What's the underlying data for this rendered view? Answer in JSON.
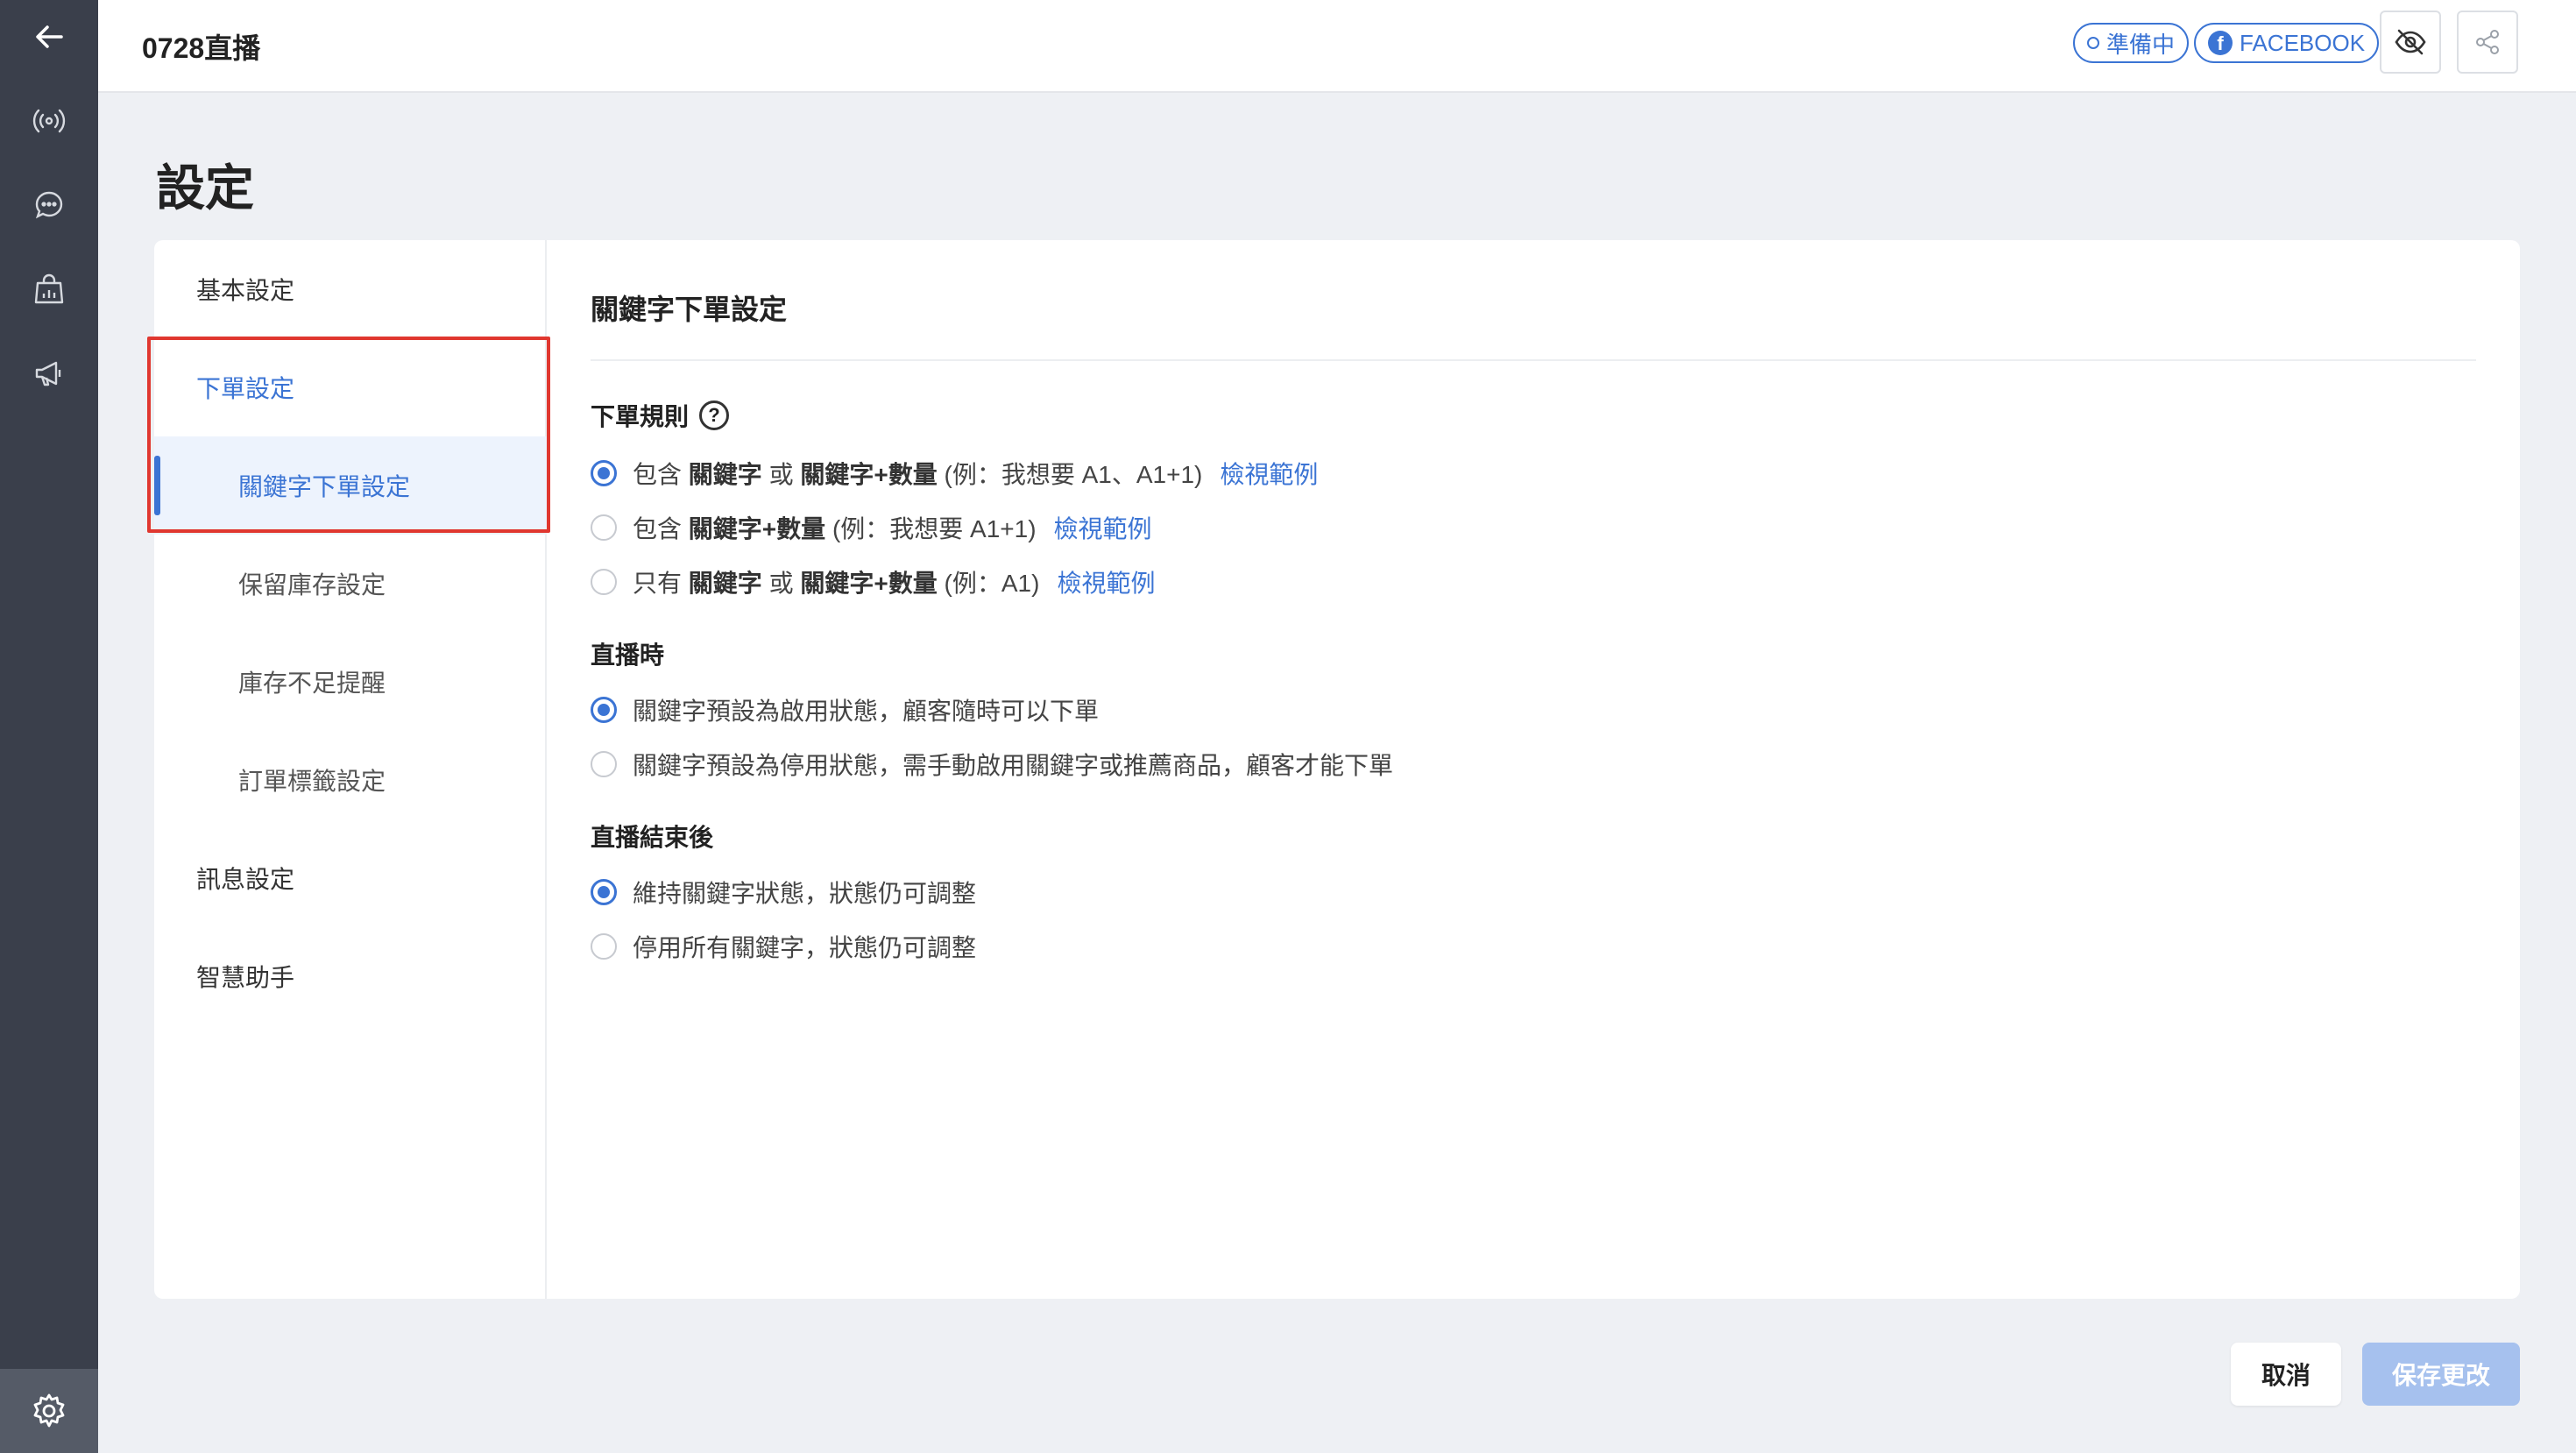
{
  "header": {
    "title": "0728直播",
    "status_badge": "準備中",
    "platform_badge": "FACEBOOK"
  },
  "page": {
    "title": "設定"
  },
  "sidenav": {
    "basic": "基本設定",
    "order": "下單設定",
    "keyword_order": "關鍵字下單設定",
    "reserve_stock": "保留庫存設定",
    "low_stock": "庫存不足提醒",
    "order_tag": "訂單標籤設定",
    "message": "訊息設定",
    "assistant": "智慧助手"
  },
  "content": {
    "title": "關鍵字下單設定",
    "order_rules": {
      "label": "下單規則",
      "options": [
        {
          "prefix": "包含",
          "kw1": "關鍵字",
          "or": "或",
          "kw2": "關鍵字+數量",
          "example": "(例：我想要 A1、A1+1)",
          "link": "檢視範例",
          "checked": true
        },
        {
          "prefix": "包含",
          "kw2": "關鍵字+數量",
          "example": "(例：我想要 A1+1)",
          "link": "檢視範例",
          "checked": false
        },
        {
          "prefix": "只有",
          "kw1": "關鍵字",
          "or": "或",
          "kw2": "關鍵字+數量",
          "example": "(例：A1)",
          "link": "檢視範例",
          "checked": false
        }
      ]
    },
    "during_live": {
      "label": "直播時",
      "options": [
        {
          "text": "關鍵字預設為啟用狀態，顧客隨時可以下單",
          "checked": true
        },
        {
          "text": "關鍵字預設為停用狀態，需手動啟用關鍵字或推薦商品，顧客才能下單",
          "checked": false
        }
      ]
    },
    "after_live": {
      "label": "直播結束後",
      "options": [
        {
          "text": "維持關鍵字狀態，狀態仍可調整",
          "checked": true
        },
        {
          "text": "停用所有關鍵字，狀態仍可調整",
          "checked": false
        }
      ]
    }
  },
  "footer": {
    "cancel": "取消",
    "save": "保存更改"
  },
  "colors": {
    "accent": "#3b74d4",
    "sidebar": "#3a3f4b",
    "highlight": "#e0372f"
  }
}
